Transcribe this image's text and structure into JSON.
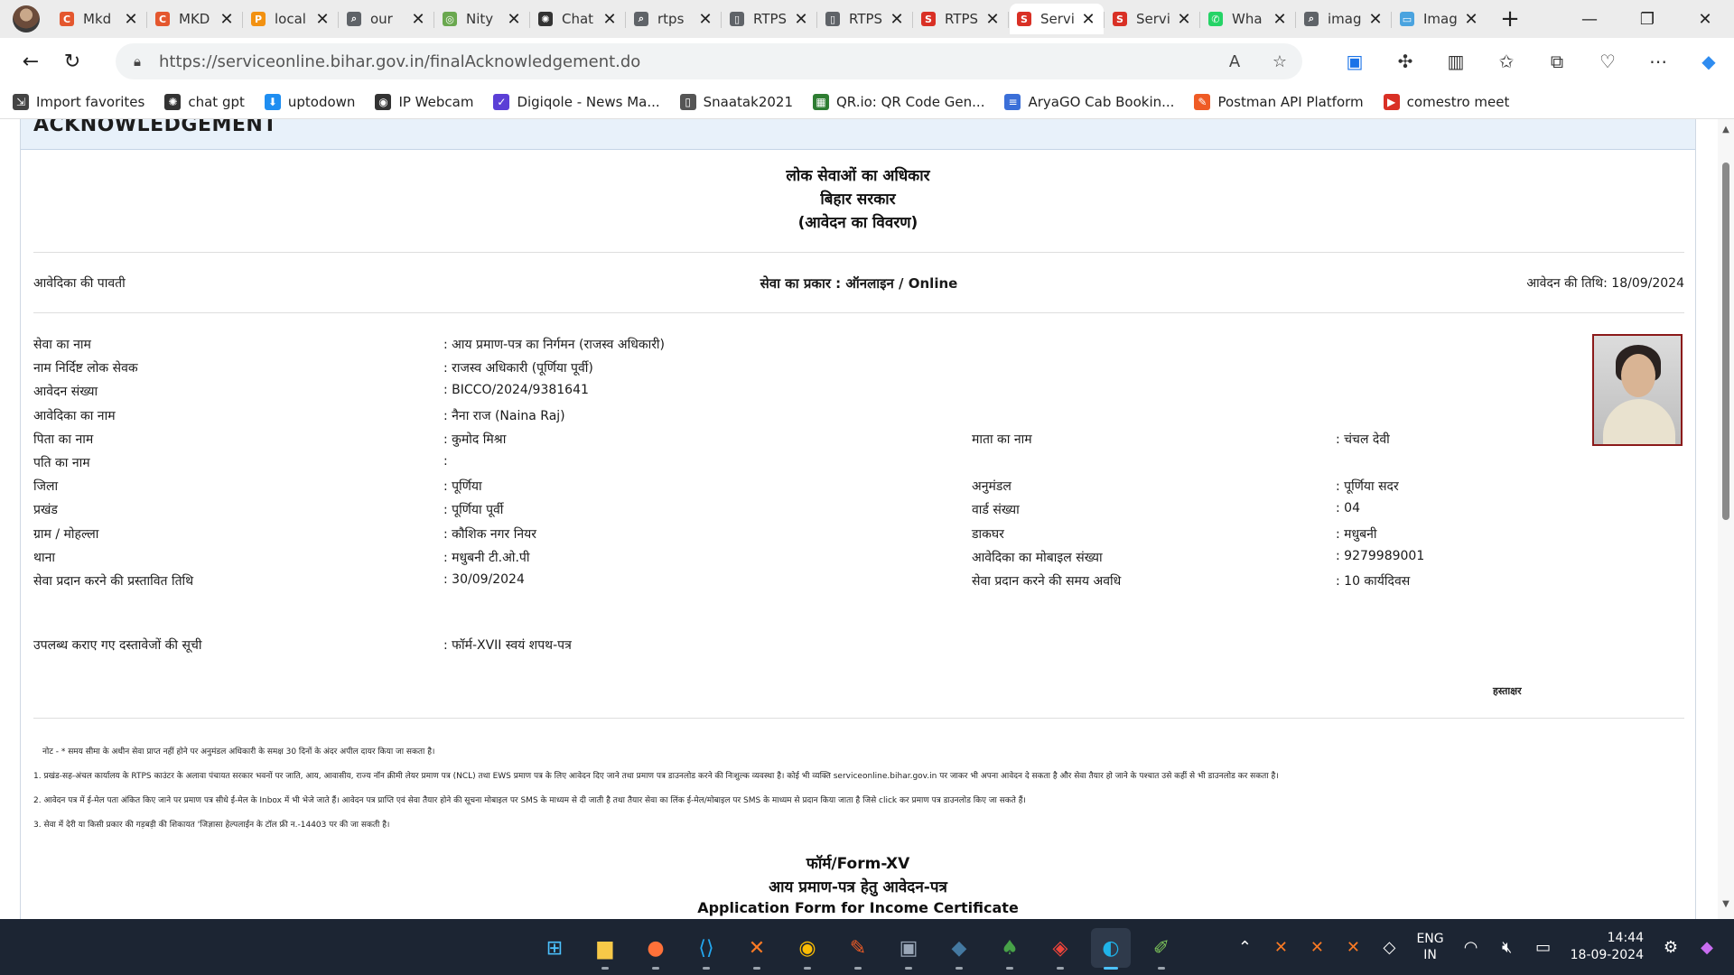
{
  "browser": {
    "tabs": [
      {
        "label": "Mkd",
        "icon": "coursera-icon",
        "color": "#e4572e",
        "glyph": "C"
      },
      {
        "label": "MKD",
        "icon": "coursera-icon",
        "color": "#e4572e",
        "glyph": "C"
      },
      {
        "label": "local",
        "icon": "phpmyadmin-icon",
        "color": "#f29111",
        "glyph": "P"
      },
      {
        "label": "our",
        "icon": "search-icon",
        "color": "#5f6368",
        "glyph": "⌕"
      },
      {
        "label": "Nity",
        "icon": "site-icon",
        "color": "#6aa84f",
        "glyph": "◎"
      },
      {
        "label": "Chat",
        "icon": "chatgpt-icon",
        "color": "#333333",
        "glyph": "✺"
      },
      {
        "label": "rtps",
        "icon": "search-icon",
        "color": "#5f6368",
        "glyph": "⌕"
      },
      {
        "label": "RTPS",
        "icon": "page-icon",
        "color": "#5f6368",
        "glyph": "▯"
      },
      {
        "label": "RTPS",
        "icon": "page-icon",
        "color": "#5f6368",
        "glyph": "▯"
      },
      {
        "label": "RTPS",
        "icon": "serviceplus-icon",
        "color": "#d93025",
        "glyph": "S"
      },
      {
        "label": "Servi",
        "icon": "serviceplus-icon",
        "color": "#d93025",
        "glyph": "S",
        "active": true
      },
      {
        "label": "Servi",
        "icon": "serviceplus-icon",
        "color": "#d93025",
        "glyph": "S"
      },
      {
        "label": "Wha",
        "icon": "whatsapp-icon",
        "color": "#25d366",
        "glyph": "✆"
      },
      {
        "label": "imag",
        "icon": "search-icon",
        "color": "#5f6368",
        "glyph": "⌕"
      },
      {
        "label": "Imag",
        "icon": "image-icon",
        "color": "#4aa3df",
        "glyph": "▭"
      }
    ],
    "url": "https://serviceonline.bihar.gov.in/finalAcknowledgement.do",
    "favorites": [
      {
        "label": "Import favorites",
        "icon": "import-icon",
        "color": "#444444",
        "glyph": "⇲"
      },
      {
        "label": "chat gpt",
        "icon": "chatgpt-icon",
        "color": "#333333",
        "glyph": "✺"
      },
      {
        "label": "uptodown",
        "icon": "uptodown-icon",
        "color": "#1f8ef1",
        "glyph": "⬇"
      },
      {
        "label": "IP Webcam",
        "icon": "webcam-icon",
        "color": "#333333",
        "glyph": "◉"
      },
      {
        "label": "Digiqole - News Ma...",
        "icon": "digiqole-icon",
        "color": "#5b3fd6",
        "glyph": "✓"
      },
      {
        "label": "Snaatak2021",
        "icon": "page-icon",
        "color": "#555555",
        "glyph": "▯"
      },
      {
        "label": "QR.io: QR Code Gen...",
        "icon": "qr-icon",
        "color": "#2e7d32",
        "glyph": "▦"
      },
      {
        "label": "AryaGO Cab Bookin...",
        "icon": "doc-icon",
        "color": "#3b6fd8",
        "glyph": "≡"
      },
      {
        "label": "Postman API Platform",
        "icon": "postman-icon",
        "color": "#ef5b25",
        "glyph": "✎"
      },
      {
        "label": "comestro meet",
        "icon": "meet-icon",
        "color": "#d93025",
        "glyph": "▶"
      }
    ]
  },
  "page": {
    "section_title": "ACKNOWLEDGEMENT",
    "heading": [
      "लोक सेवाओं का अधिकार",
      "बिहार सरकार",
      "(आवेदन का विवरण)"
    ],
    "receipt_label": "आवेदिका की पावती",
    "service_type": "सेवा का प्रकार : ऑनलाइन / Online",
    "application_date": "आवेदन की तिथि: 18/09/2024",
    "left_fields": [
      {
        "label": "सेवा का नाम",
        "value": ": आय प्रमाण-पत्र का निर्गमन (राजस्व अधिकारी)"
      },
      {
        "label": "नाम निर्दिष्ट लोक सेवक",
        "value": ": राजस्व अधिकारी (पूर्णिया पूर्वी)"
      },
      {
        "label": "आवेदन संख्या",
        "value": ": BICCO/2024/9381641"
      },
      {
        "label": "आवेदिका का नाम",
        "value": ": नैना राज (Naina Raj)"
      },
      {
        "label": "पिता का नाम",
        "value": ": कुमोद मिश्रा"
      },
      {
        "label": "पति का नाम",
        "value": ":"
      },
      {
        "label": "जिला",
        "value": ": पूर्णिया"
      },
      {
        "label": "प्रखंड",
        "value": ": पूर्णिया पूर्वी"
      },
      {
        "label": "ग्राम / मोहल्ला",
        "value": ": कौशिक नगर नियर"
      },
      {
        "label": "थाना",
        "value": ": मधुबनी टी.ओ.पी"
      },
      {
        "label": "सेवा प्रदान करने की प्रस्तावित तिथि",
        "value": ": 30/09/2024"
      }
    ],
    "right_fields": [
      {
        "label": "माता का नाम",
        "value": ": चंचल देवी"
      },
      {
        "label": "अनुमंडल",
        "value": ": पूर्णिया सदर"
      },
      {
        "label": "वार्ड संख्या",
        "value": ": 04"
      },
      {
        "label": "डाकघर",
        "value": ": मधुबनी"
      },
      {
        "label": "आवेदिका का मोबाइल संख्या",
        "value": ": 9279989001"
      },
      {
        "label": "सेवा प्रदान करने की समय अवधि",
        "value": ": 10 कार्यदिवस"
      }
    ],
    "documents_label": "उपलब्ध कराए गए दस्तावेजों की सूची",
    "documents_value": ": फॉर्म-XVII स्वयं शपथ-पत्र",
    "signature_label": "हस्ताक्षर",
    "notes": [
      "नोट - * समय सीमा के अधीन सेवा प्राप्त नहीं होने पर अनुमंडल अधिकारी के समक्ष 30 दिनों के अंदर अपील दायर किया जा सकता है।",
      "1. प्रखंड-सह-अंचल कार्यालय के RTPS काउंटर के अलावा पंचायत सरकार भवनों पर जाति, आय, आवासीय, राज्य नॉन क्रीमी लेयर प्रमाण पत्र (NCL) तथा EWS प्रमाण पत्र के लिए आवेदन दिए जाने तथा प्रमाण पत्र डाउनलोड करने की निःशुल्क व्यवस्था है। कोई भी व्यक्ति serviceonline.bihar.gov.in पर जाकर भी अपना आवेदन दे सकता है और सेवा तैयार हो जाने के पश्चात उसे कहीं से भी डाउनलोड कर सकता है।",
      "2. आवेदन पत्र में ई-मेल पता अंकित किए जाने पर प्रमाण पत्र सीधे ई-मेल के Inbox में भी भेजे जाते हैं। आवेदन पत्र प्राप्ति एवं सेवा तैयार होने की सूचना मोबाइल पर SMS के माध्यम से दी जाती है तथा तैयार सेवा का लिंक ई-मेल/मोबाइल पर SMS के माध्यम से प्रदान किया जाता है जिसे click कर प्रमाण पत्र डाउनलोड किए जा सकते हैं।",
      "3. सेवा में देरी या किसी प्रकार की गड़बड़ी की शिकायत 'जिज्ञासा हेल्पलाईन के टॉल फ्री न.-14403 पर की जा सकती है।"
    ],
    "form_heading": [
      "फॉर्म/Form-XV",
      "आय प्रमाण-पत्र हेतु आवेदन-पत्र",
      "Application Form for Income Certificate"
    ]
  },
  "taskbar": {
    "apps": [
      {
        "name": "start-icon",
        "glyph": "⊞",
        "color": "#4cc2ff"
      },
      {
        "name": "file-explorer-icon",
        "glyph": "▆",
        "color": "#f7c948"
      },
      {
        "name": "firefox-icon",
        "glyph": "●",
        "color": "#ff7139"
      },
      {
        "name": "vscode-icon",
        "glyph": "⟨⟩",
        "color": "#23a9f2"
      },
      {
        "name": "xampp-icon",
        "glyph": "✕",
        "color": "#fb7a24"
      },
      {
        "name": "chrome-icon",
        "glyph": "◉",
        "color": "#fbbc04"
      },
      {
        "name": "postman-icon",
        "glyph": "✎",
        "color": "#ef5b25"
      },
      {
        "name": "store-icon",
        "glyph": "▣",
        "color": "#9aa7b8"
      },
      {
        "name": "mysql-workbench-icon",
        "glyph": "◆",
        "color": "#4479a1"
      },
      {
        "name": "mongodb-icon",
        "glyph": "♠",
        "color": "#47a248"
      },
      {
        "name": "anydesk-icon",
        "glyph": "◈",
        "color": "#ef443b"
      },
      {
        "name": "edge-icon",
        "glyph": "◐",
        "color": "#1fb3e9",
        "active": true
      },
      {
        "name": "paint-icon",
        "glyph": "✐",
        "color": "#7cc35a"
      }
    ],
    "language": [
      "ENG",
      "IN"
    ],
    "time": "14:44",
    "date": "18-09-2024"
  }
}
